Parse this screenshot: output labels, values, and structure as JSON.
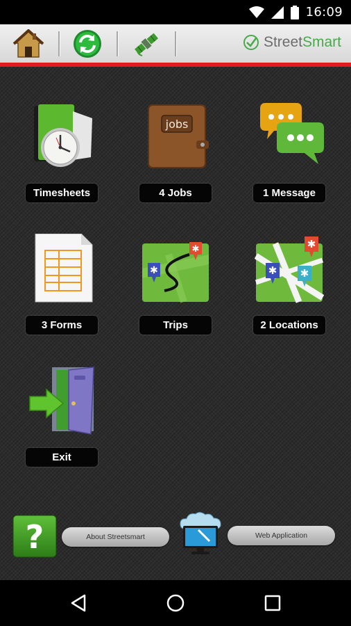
{
  "status": {
    "time": "16:09"
  },
  "toolbar": {
    "brand_part1": "Street",
    "brand_part2": "Smart",
    "home_icon": "home-icon",
    "sync_icon": "sync-icon",
    "gps_icon": "satellite-icon"
  },
  "tiles": [
    {
      "label": "Timesheets",
      "icon": "timesheet-clock-icon"
    },
    {
      "label": "4 Jobs",
      "icon": "jobs-wallet-icon"
    },
    {
      "label": "1 Message",
      "icon": "chat-bubbles-icon"
    },
    {
      "label": "3 Forms",
      "icon": "form-document-icon"
    },
    {
      "label": "Trips",
      "icon": "trips-map-icon"
    },
    {
      "label": "2 Locations",
      "icon": "locations-map-icon"
    },
    {
      "label": "Exit",
      "icon": "exit-door-icon"
    }
  ],
  "footer": {
    "about_label": "About Streetsmart",
    "web_label": "Web Application",
    "help_icon": "help-icon",
    "cloud_icon": "cloud-computer-icon"
  },
  "colors": {
    "accent_red": "#e41b1b",
    "brand_green": "#48a94a"
  }
}
